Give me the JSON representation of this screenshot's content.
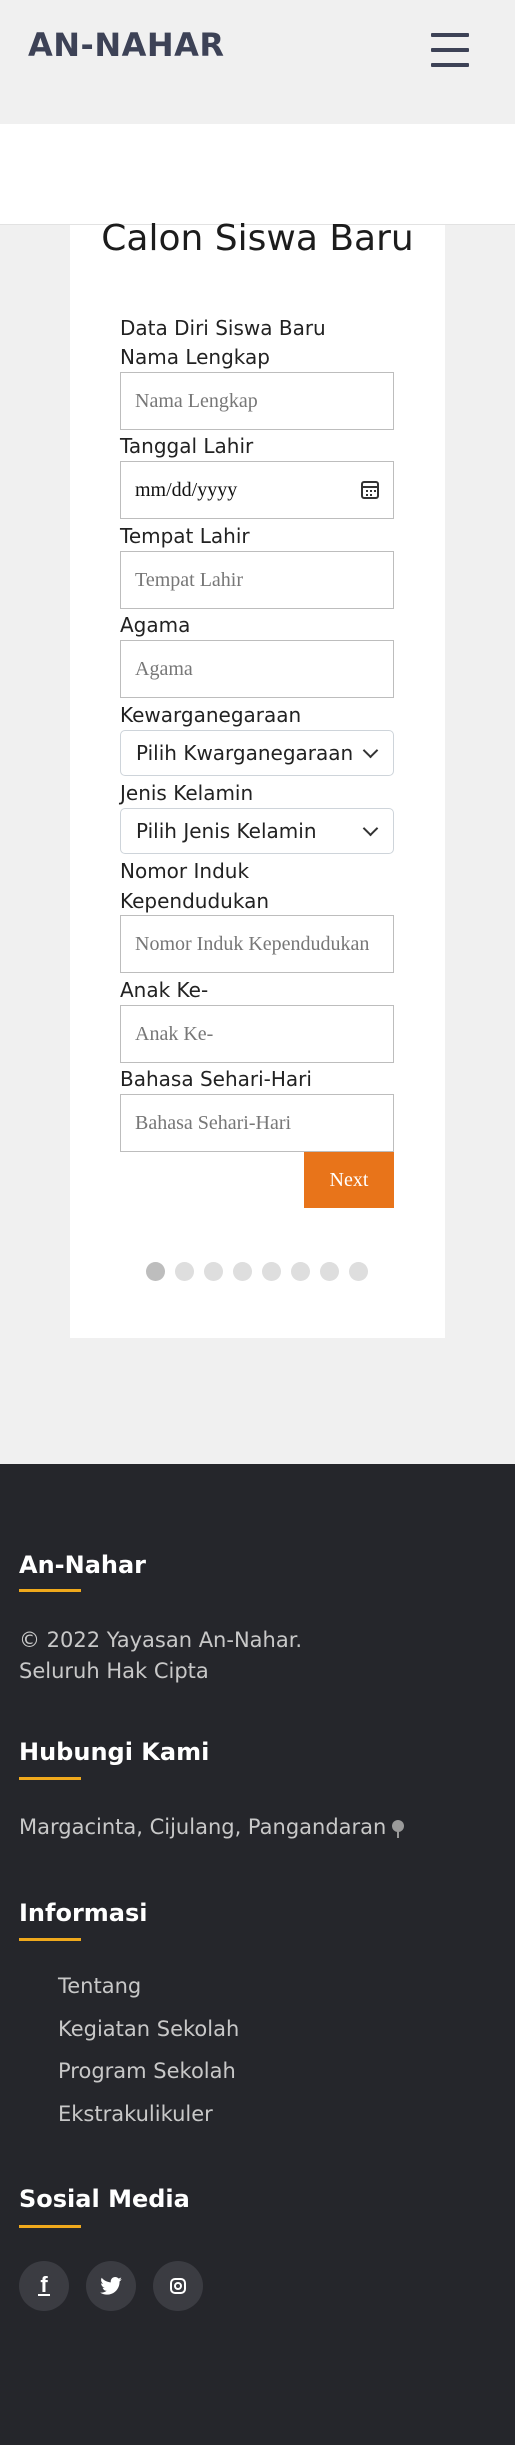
{
  "header": {
    "brand": "AN-NAHAR",
    "menu_icon": "hamburger-menu-icon"
  },
  "form": {
    "title": "Calon Siswa Baru",
    "section_label": "Data Diri Siswa Baru",
    "fields": {
      "nama_lengkap": {
        "label": "Nama Lengkap",
        "placeholder": "Nama Lengkap"
      },
      "tanggal_lahir": {
        "label": "Tanggal Lahir",
        "value": "mm/dd/yyyy",
        "icon": "calendar-icon"
      },
      "tempat_lahir": {
        "label": "Tempat Lahir",
        "placeholder": "Tempat Lahir"
      },
      "agama": {
        "label": "Agama",
        "placeholder": "Agama"
      },
      "kewarganegaraan": {
        "label": "Kewarganegaraan",
        "selected": "Pilih Kwarganegaraan"
      },
      "jenis_kelamin": {
        "label": "Jenis Kelamin",
        "selected": "Pilih Jenis Kelamin"
      },
      "nik": {
        "label_line1": "Nomor Induk",
        "label_line2": "Kependudukan",
        "placeholder": "Nomor Induk Kependudukan"
      },
      "anak_ke": {
        "label": "Anak Ke-",
        "placeholder": "Anak Ke-"
      },
      "bahasa": {
        "label": "Bahasa Sehari-Hari",
        "placeholder": "Bahasa Sehari-Hari"
      }
    },
    "next_label": "Next",
    "step_indicator": {
      "total": 8,
      "current": 1
    },
    "colors": {
      "next_button": "#e8741a"
    }
  },
  "footer": {
    "about": {
      "heading": "An-Nahar",
      "line1": "© 2022 Yayasan An-Nahar.",
      "line2": "Seluruh Hak Cipta"
    },
    "contact": {
      "heading": "Hubungi Kami",
      "address": "Margacinta, Cijulang, Pangandaran",
      "icon": "location-pin-icon"
    },
    "info": {
      "heading": "Informasi",
      "links": [
        "Tentang",
        "Kegiatan Sekolah",
        "Program Sekolah",
        "Ekstrakulikuler"
      ]
    },
    "social": {
      "heading": "Sosial Media",
      "icons": [
        "facebook-icon",
        "twitter-icon",
        "instagram-icon"
      ]
    },
    "colors": {
      "background": "#25262b",
      "accent": "#f0a91c"
    }
  }
}
